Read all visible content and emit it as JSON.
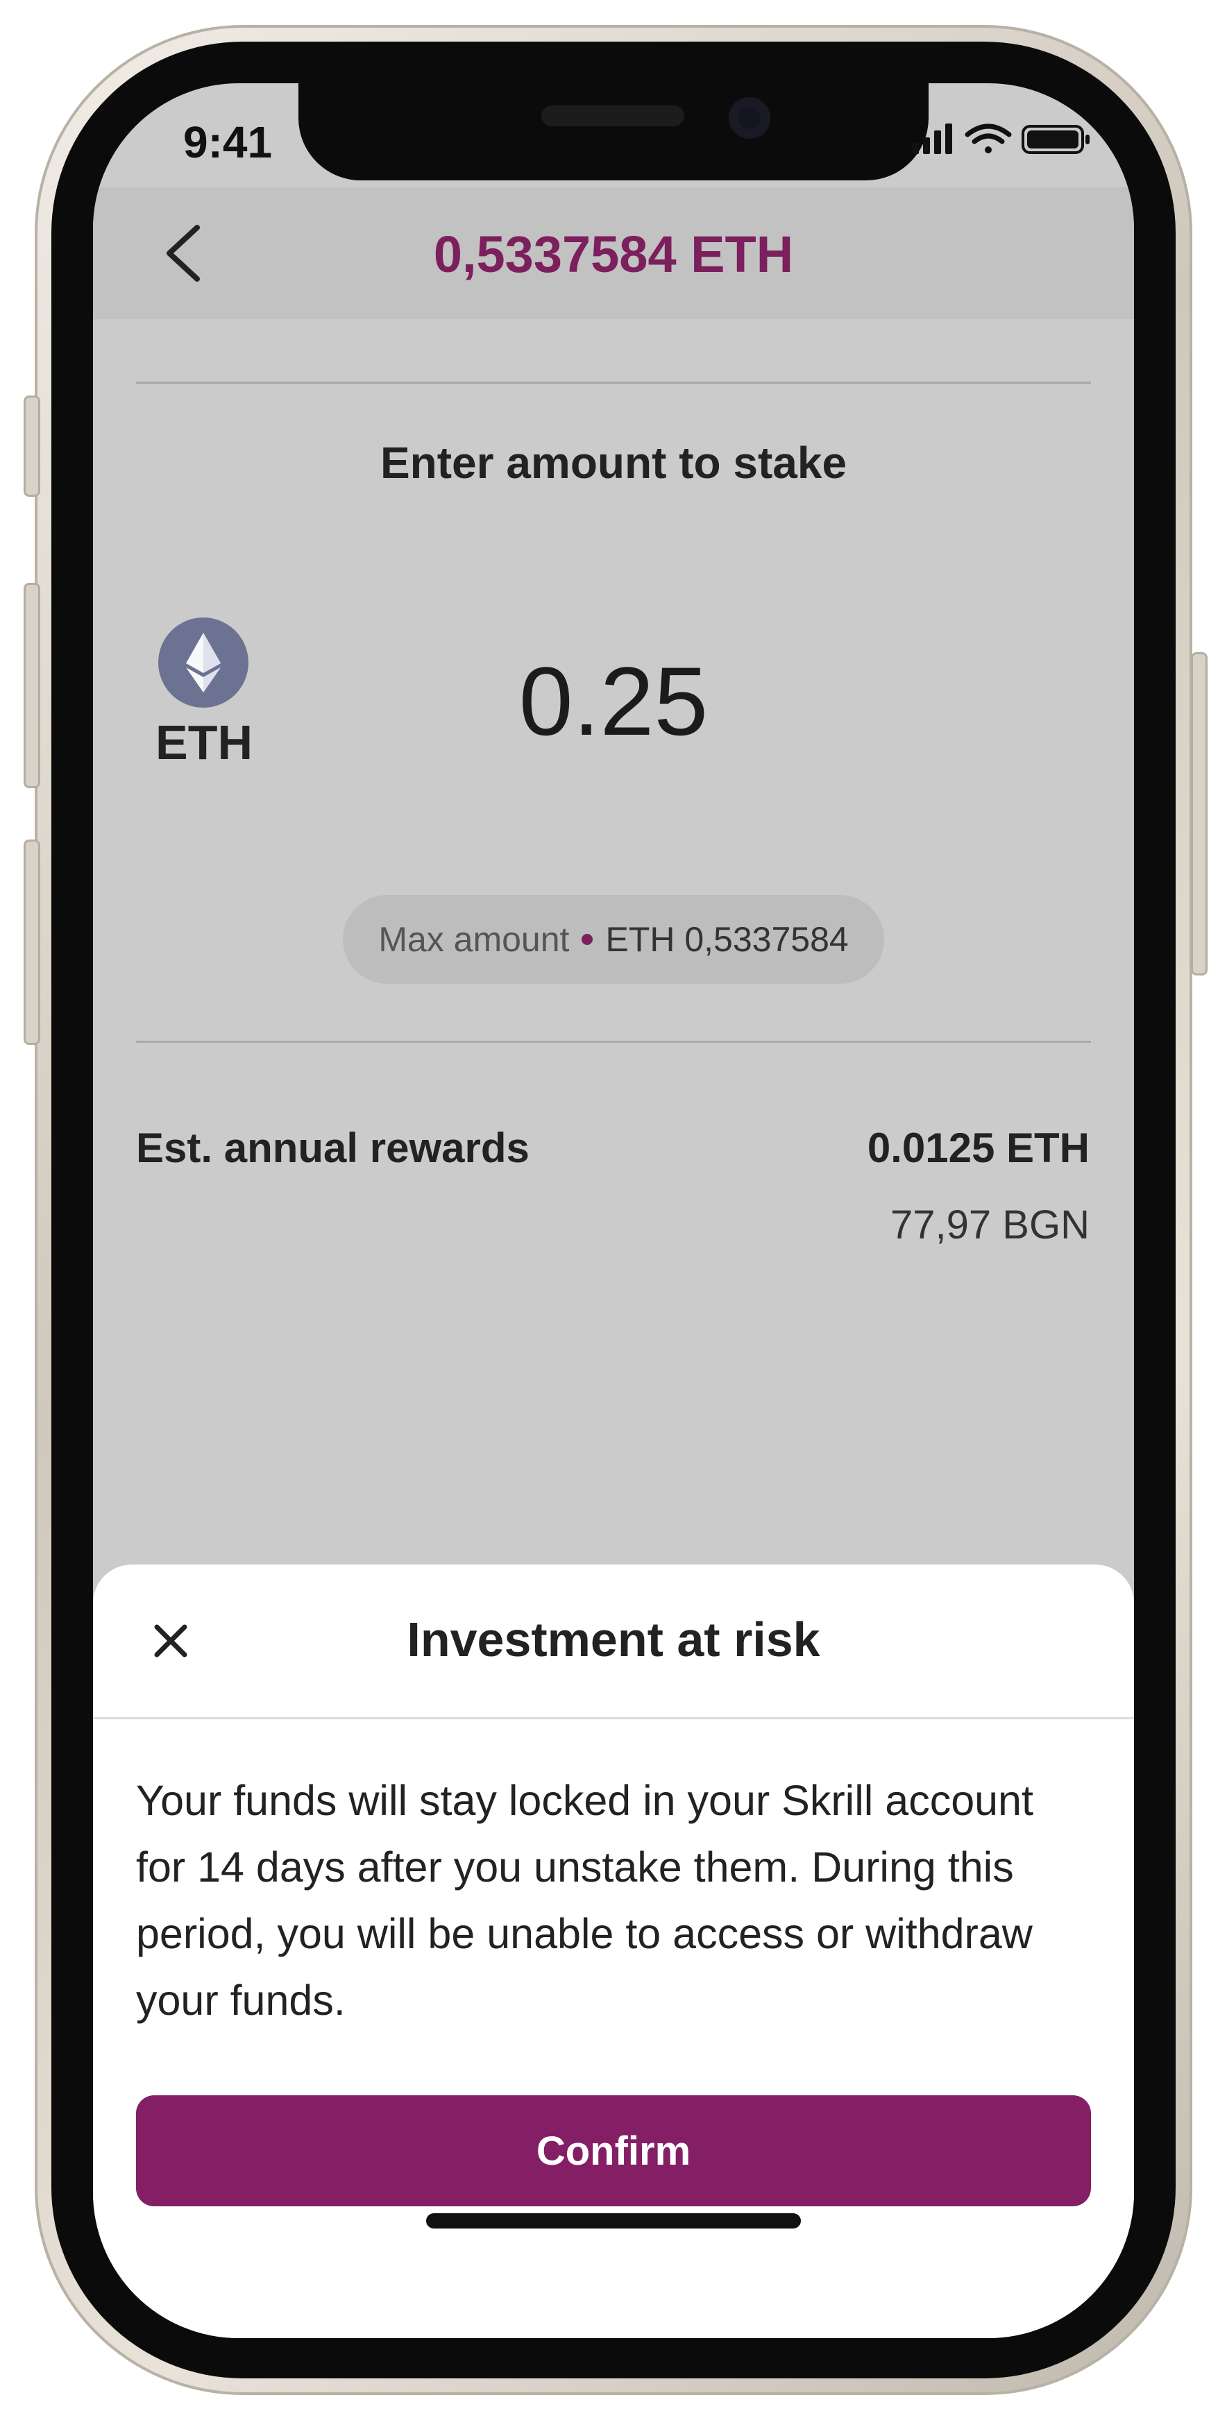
{
  "status_bar": {
    "time": "9:41"
  },
  "header": {
    "title": "0,5337584 ETH"
  },
  "stake": {
    "prompt": "Enter amount to stake",
    "asset_label": "ETH",
    "amount": "0.25",
    "max_label": "Max amount",
    "max_value": "ETH 0,5337584"
  },
  "rewards": {
    "label": "Est. annual rewards",
    "eth_value": "0.0125 ETH",
    "fiat_value": "77,97 BGN"
  },
  "sheet": {
    "title": "Investment at risk",
    "body": "Your funds will stay locked in your Skrill account for 14 days after you unstake them. During this period, you will be unable to access or withdraw your funds.",
    "confirm_label": "Confirm"
  },
  "colors": {
    "brand": "#841f66",
    "title": "#7b1f5d",
    "eth_icon": "#6c7291"
  },
  "icons": [
    "back-arrow-icon",
    "ethereum-icon",
    "close-icon",
    "signal-icon",
    "wifi-icon",
    "battery-icon"
  ]
}
